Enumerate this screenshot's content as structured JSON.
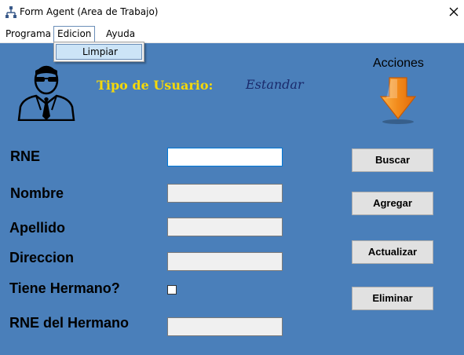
{
  "window": {
    "title": "Form Agent (Area de Trabajo)",
    "icon": "app-tree-icon",
    "close_icon": "close-icon"
  },
  "menu": {
    "items": [
      {
        "label": "Programa"
      },
      {
        "label": "Edicion",
        "open": true
      },
      {
        "label": "Ayuda"
      }
    ],
    "dropdown": {
      "items": [
        {
          "label": "Limpiar",
          "highlighted": true
        }
      ]
    }
  },
  "header": {
    "user_type_label": "Tipo de Usuario:",
    "user_type_value": "Estandar",
    "actions_title": "Acciones",
    "agent_icon": "secret-agent-icon",
    "arrow_icon": "orange-down-arrow-icon"
  },
  "form": {
    "rne_label": "RNE",
    "rne_value": "",
    "nombre_label": "Nombre",
    "nombre_value": "",
    "apellido_label": "Apellido",
    "apellido_value": "",
    "direccion_label": "Direccion",
    "direccion_value": "",
    "tiene_hermano_label": "Tiene Hermano?",
    "tiene_hermano_checked": false,
    "rne_hermano_label": "RNE del Hermano",
    "rne_hermano_value": ""
  },
  "actions": {
    "buscar": "Buscar",
    "agregar": "Agregar",
    "actualizar": "Actualizar",
    "eliminar": "Eliminar"
  },
  "colors": {
    "background": "#4a7fba",
    "user_type_label": "#f5d90a",
    "user_type_value": "#1a2a6c",
    "arrow": "#f28a1a"
  }
}
